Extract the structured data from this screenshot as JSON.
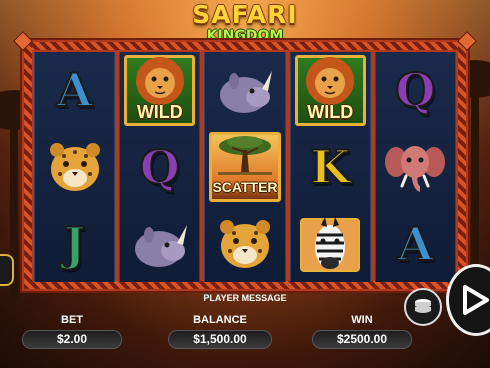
{
  "logo": {
    "line1": "SAFARI",
    "line2": "KINGDOM"
  },
  "reels": [
    [
      {
        "type": "letter",
        "value": "A",
        "icon": "letter-a-icon"
      },
      {
        "type": "animal",
        "animal": "leopard",
        "icon": "leopard-icon"
      },
      {
        "type": "letter",
        "value": "J",
        "icon": "letter-j-icon"
      }
    ],
    [
      {
        "type": "wild",
        "animal": "lion",
        "label": "WILD",
        "icon": "lion-wild-icon"
      },
      {
        "type": "letter",
        "value": "Q",
        "icon": "letter-q-icon"
      },
      {
        "type": "animal",
        "animal": "rhino",
        "icon": "rhino-icon"
      }
    ],
    [
      {
        "type": "animal",
        "animal": "rhino",
        "icon": "rhino-icon"
      },
      {
        "type": "scatter",
        "label": "SCATTER",
        "icon": "acacia-tree-scatter-icon"
      },
      {
        "type": "animal",
        "animal": "leopard",
        "icon": "leopard-icon"
      }
    ],
    [
      {
        "type": "wild",
        "animal": "lion",
        "label": "WILD",
        "icon": "lion-wild-icon"
      },
      {
        "type": "letter",
        "value": "K",
        "icon": "letter-k-icon"
      },
      {
        "type": "animal",
        "animal": "zebra",
        "icon": "zebra-icon"
      }
    ],
    [
      {
        "type": "letter",
        "value": "Q",
        "icon": "letter-q-icon"
      },
      {
        "type": "animal",
        "animal": "elephant",
        "icon": "elephant-icon"
      },
      {
        "type": "letter",
        "value": "A",
        "icon": "letter-a-icon"
      }
    ]
  ],
  "player_message": "PLAYER MESSAGE",
  "bet": {
    "label": "BET",
    "value": "$2.00"
  },
  "balance": {
    "label": "BALANCE",
    "value": "$1,500.00"
  },
  "win": {
    "label": "WIN",
    "value": "$2500.00"
  },
  "controls": {
    "coin_icon": "coin-stack-icon",
    "spin_icon": "play-arrow-icon"
  },
  "colors": {
    "frame": "#b23a1c",
    "reel_bg": "#15244a",
    "gold": "#e9b13a"
  }
}
